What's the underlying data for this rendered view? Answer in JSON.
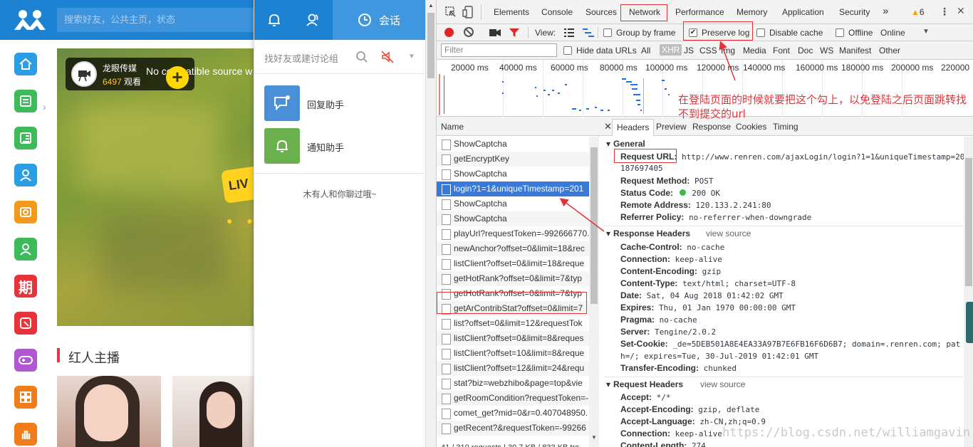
{
  "site": {
    "search_placeholder": "搜索好友，公共主页，状态",
    "anchor_name": "龙眼传媒",
    "anchor_viewer_count": "6497",
    "anchor_viewer_label": "观看",
    "video_message": "No compatible source w",
    "live_tag": "LIV",
    "live_dots": "● ●",
    "section_title": "红人主播",
    "nav_icons": [
      "home-icon",
      "list-icon",
      "news-icon",
      "user-icon",
      "photo-icon",
      "friends-icon",
      "period-icon",
      "share-icon",
      "game-icon",
      "apps-icon",
      "hand-icon"
    ],
    "nav_char_period": "期"
  },
  "chat": {
    "tab_session": "会话",
    "search_placeholder": "找好友或建讨论组",
    "assistants": [
      {
        "label": "回复助手",
        "color": "#4a90d9"
      },
      {
        "label": "通知助手",
        "color": "#6ab04c"
      }
    ],
    "empty_text": "木有人和你聊过哦~"
  },
  "devtools": {
    "tabs": [
      "Elements",
      "Console",
      "Sources",
      "Network",
      "Performance",
      "Memory",
      "Application",
      "Security"
    ],
    "more_tabs": "»",
    "warning_count": "6",
    "active_tab": "Network",
    "toolbar": {
      "view_label": "View:",
      "group_by_frame": "Group by frame",
      "preserve_log": "Preserve log",
      "preserve_log_checked": true,
      "disable_cache": "Disable cache",
      "offline": "Offline",
      "throttle": "Online"
    },
    "filter": {
      "placeholder": "Filter",
      "hide_data_urls": "Hide data URLs",
      "types": [
        "All",
        "XHR",
        "JS",
        "CSS",
        "Img",
        "Media",
        "Font",
        "Doc",
        "WS",
        "Manifest",
        "Other"
      ],
      "active_type": "XHR"
    },
    "timeline_ticks": [
      "20000 ms",
      "40000 ms",
      "60000 ms",
      "80000 ms",
      "100000 ms",
      "120000 ms",
      "140000 ms",
      "160000 ms",
      "180000 ms",
      "200000 ms",
      "220000"
    ],
    "list_header": "Name",
    "requests": [
      "ShowCaptcha",
      "getEncryptKey",
      "ShowCaptcha",
      "login?1=1&uniqueTimestamp=201",
      "ShowCaptcha",
      "ShowCaptcha",
      "playUrl?requestToken=-992666770.",
      "newAnchor?offset=0&limit=18&rec",
      "listClient?offset=0&limit=18&reque",
      "getHotRank?offset=0&limit=7&typ",
      "getHotRank?offset=0&limit=7&typ",
      "getArContribStat?offset=0&limit=7",
      "list?offset=0&limit=12&requestTok",
      "listClient?offset=0&limit=8&reques",
      "listClient?offset=10&limit=8&reque",
      "listClient?offset=12&limit=24&requ",
      "stat?biz=webzhibo&page=top&vie",
      "getRoomCondition?requestToken=-",
      "comet_get?mid=0&r=0.407048950.",
      "getRecent?&requestToken=-99266"
    ],
    "selected_index": 3,
    "status_bar": "41 / 310 requests | 39.7 KB / 833 KB tra",
    "detail_tabs": [
      "Headers",
      "Preview",
      "Response",
      "Cookies",
      "Timing"
    ],
    "general": {
      "title": "General",
      "request_url_key": "Request URL:",
      "request_url_1": "http://www.renren.com/ajaxLogin/login?1=1&uniqueTimestamp=20",
      "request_url_2": "187697405",
      "method_key": "Request Method:",
      "method": "POST",
      "status_key": "Status Code:",
      "status": "200 OK",
      "remote_key": "Remote Address:",
      "remote": "120.133.2.241:80",
      "referrer_key": "Referrer Policy:",
      "referrer": "no-referrer-when-downgrade"
    },
    "response_headers": {
      "title": "Response Headers",
      "view_source": "view source",
      "rows": [
        {
          "k": "Cache-Control:",
          "v": "no-cache"
        },
        {
          "k": "Connection:",
          "v": "keep-alive"
        },
        {
          "k": "Content-Encoding:",
          "v": "gzip"
        },
        {
          "k": "Content-Type:",
          "v": "text/html; charset=UTF-8"
        },
        {
          "k": "Date:",
          "v": "Sat, 04 Aug 2018 01:42:02 GMT"
        },
        {
          "k": "Expires:",
          "v": "Thu, 01 Jan 1970 00:00:00 GMT"
        },
        {
          "k": "Pragma:",
          "v": "no-cache"
        },
        {
          "k": "Server:",
          "v": "Tengine/2.0.2"
        },
        {
          "k": "Set-Cookie:",
          "v": "_de=5DEB501A8E4EA33A97B7E6FB16F6D6B7; domain=.renren.com; pat"
        },
        {
          "k": "",
          "v": "h=/; expires=Tue, 30-Jul-2019 01:42:01 GMT"
        },
        {
          "k": "Transfer-Encoding:",
          "v": "chunked"
        }
      ]
    },
    "request_headers": {
      "title": "Request Headers",
      "view_source": "view source",
      "rows": [
        {
          "k": "Accept:",
          "v": "*/*"
        },
        {
          "k": "Accept-Encoding:",
          "v": "gzip, deflate"
        },
        {
          "k": "Accept-Language:",
          "v": "zh-CN,zh;q=0.9"
        },
        {
          "k": "Connection:",
          "v": "keep-alive"
        },
        {
          "k": "Content-Length:",
          "v": "274"
        }
      ]
    }
  },
  "annotation": {
    "text": "在登陆页面的时候就要把这个勾上，以免登陆之后页面跳转找不到提交的url",
    "color": "#e0333a"
  },
  "watermark": "https://blog.csdn.net/williamgavin"
}
